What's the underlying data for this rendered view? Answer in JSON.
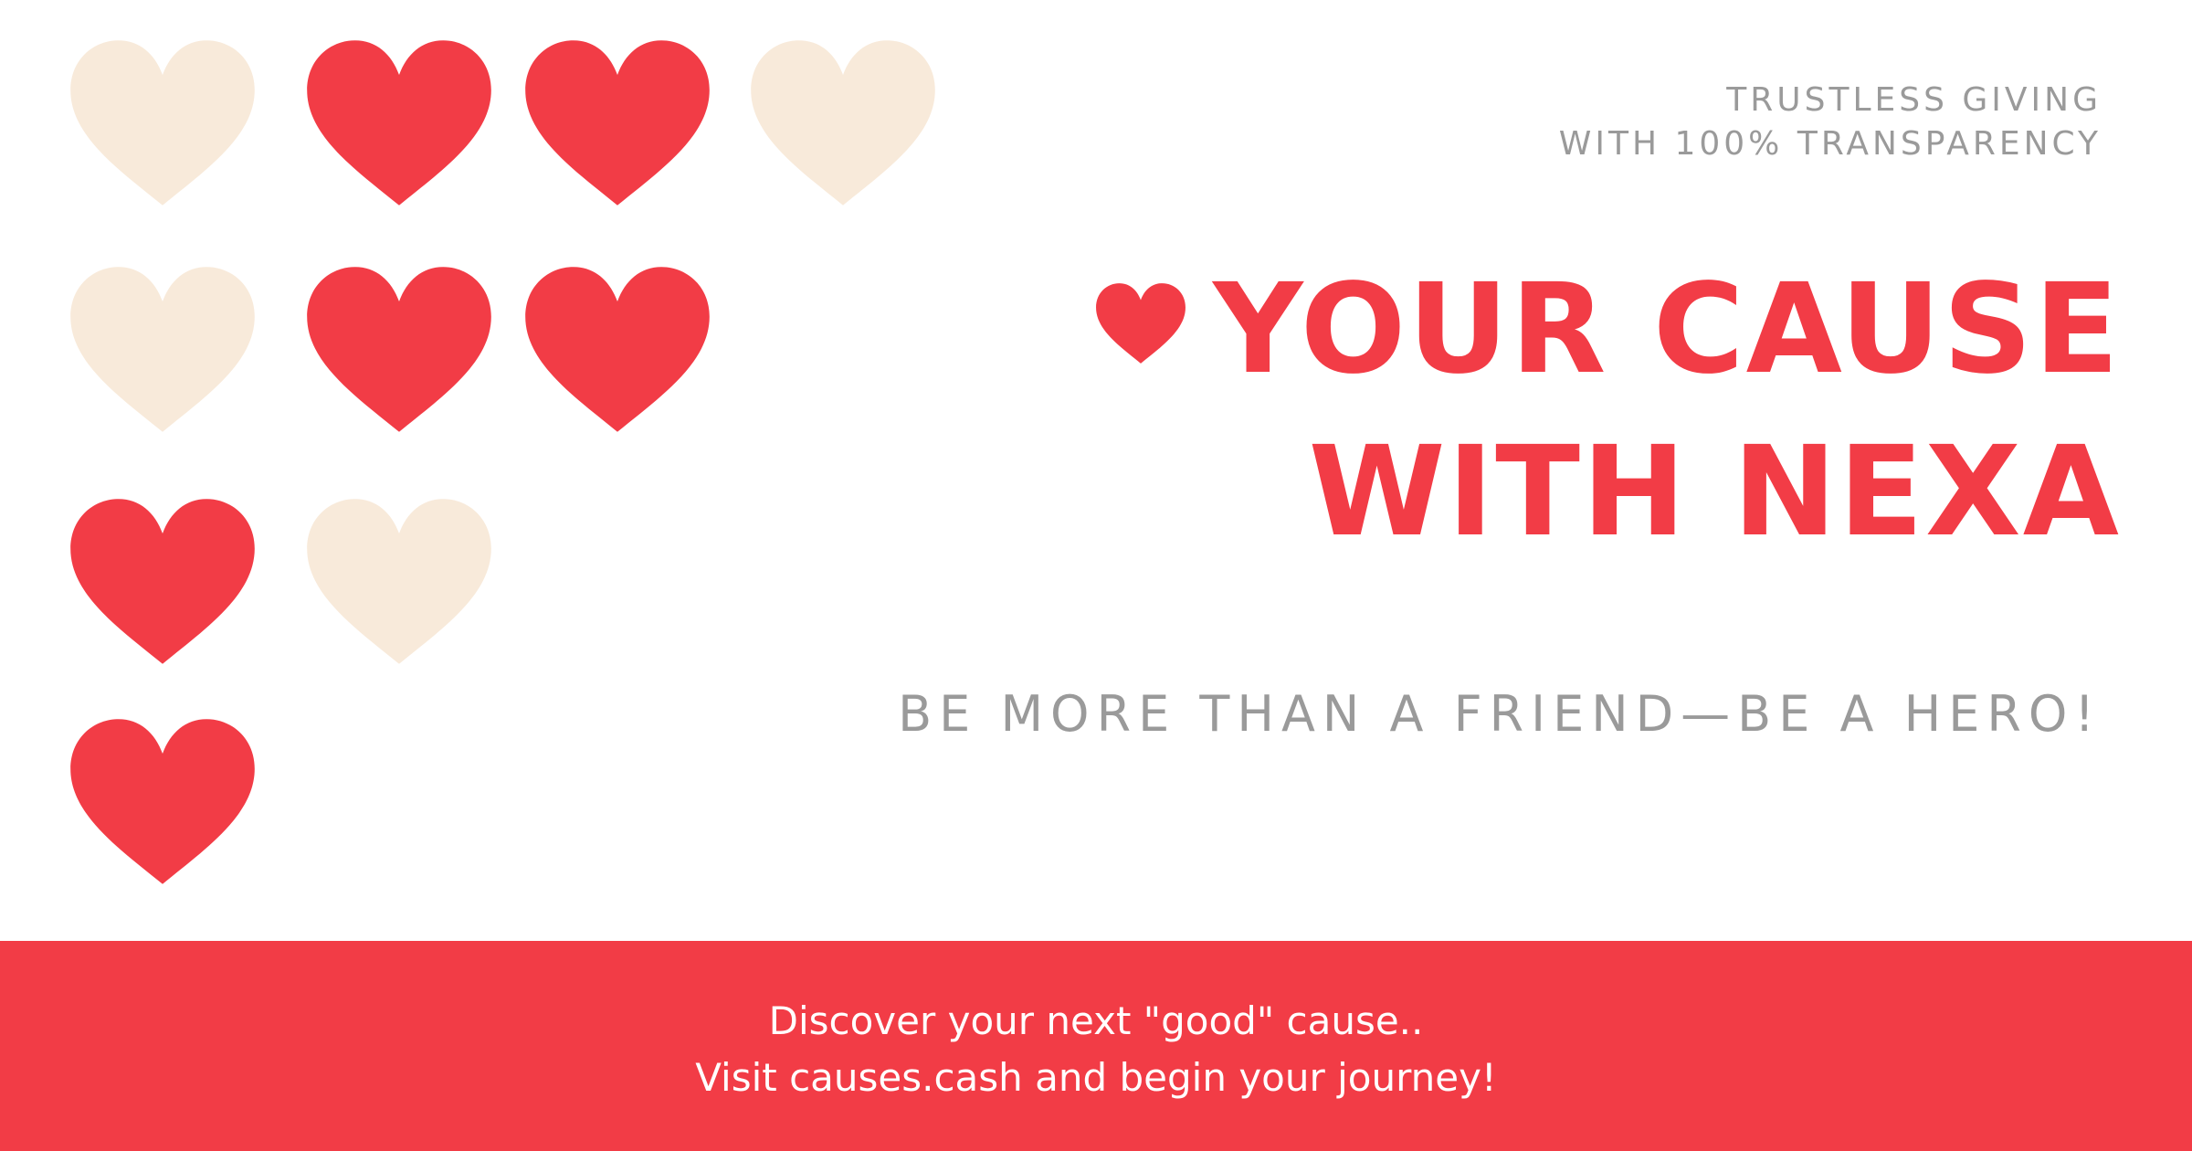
{
  "colors": {
    "red": "#f23c46",
    "cream": "#f8eada",
    "gray": "#9a9a9a",
    "white": "#ffffff"
  },
  "hearts": {
    "grid": [
      [
        "cream",
        "red",
        "red",
        "cream"
      ],
      [
        "cream",
        "red",
        "red"
      ],
      [
        "red",
        "cream"
      ],
      [
        "red"
      ]
    ]
  },
  "tagline": {
    "line1": "TRUSTLESS GIVING",
    "line2": "WITH 100% TRANSPARENCY"
  },
  "headline": {
    "line1": "YOUR CAUSE",
    "line2": "WITH NEXA",
    "icon": "heart-icon"
  },
  "slogan": "BE MORE THAN A FRIEND—BE A HERO!",
  "footer": {
    "line1": "Discover your next \"good\" cause..",
    "line2": "Visit causes.cash and begin your journey!"
  }
}
